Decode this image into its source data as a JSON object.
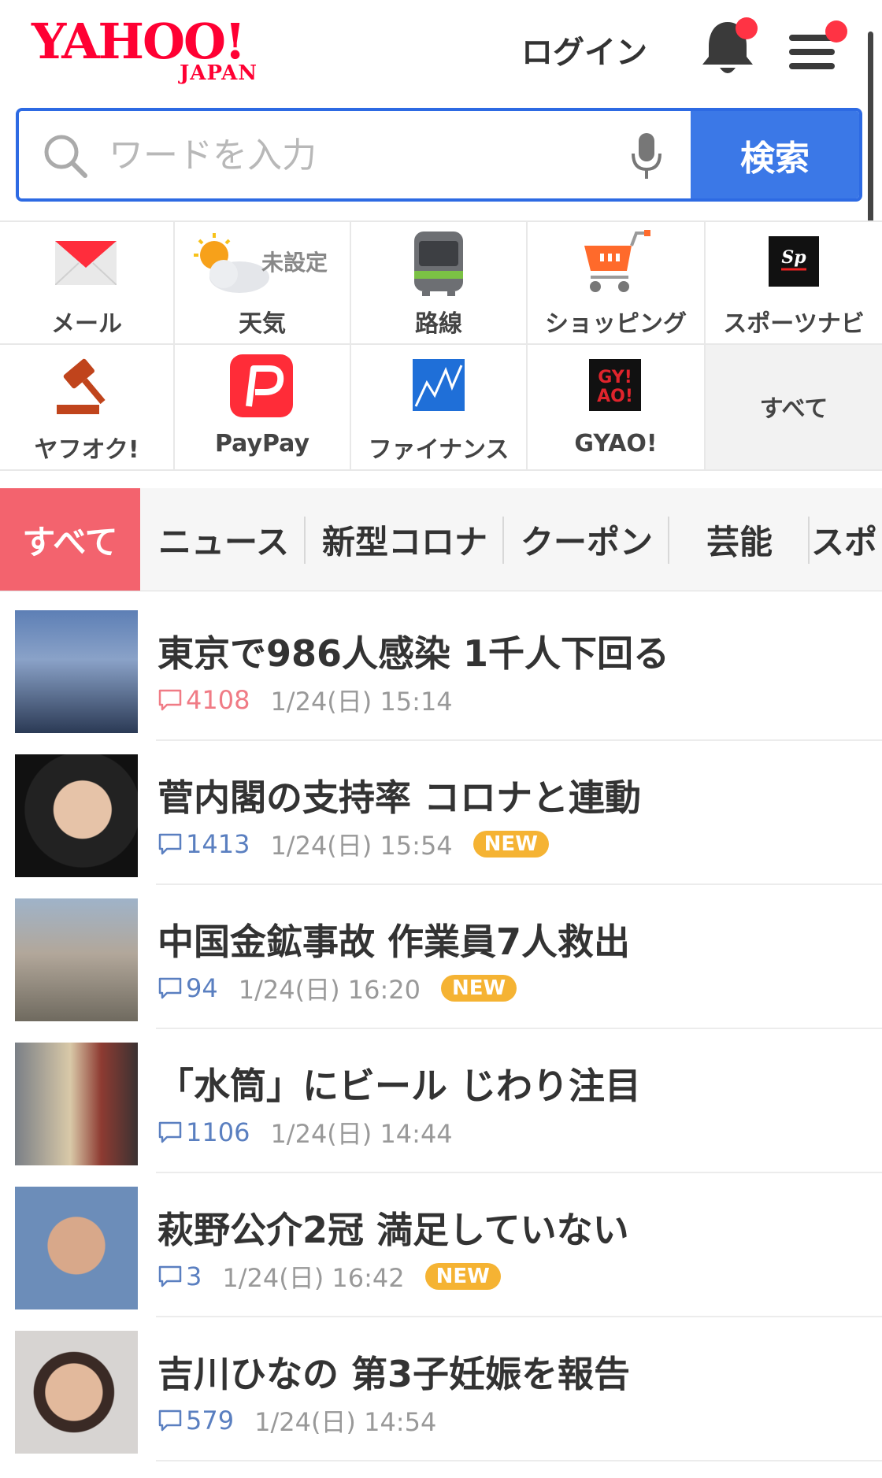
{
  "header": {
    "logo_main": "YAHOO!",
    "logo_sub": "JAPAN",
    "login_label": "ログイン"
  },
  "search": {
    "placeholder": "ワードを入力",
    "button_label": "検索"
  },
  "services": [
    {
      "label": "メール",
      "icon": "mail-icon"
    },
    {
      "label": "天気",
      "icon": "weather-icon",
      "status": "未設定"
    },
    {
      "label": "路線",
      "icon": "train-icon"
    },
    {
      "label": "ショッピング",
      "icon": "cart-icon"
    },
    {
      "label": "スポーツナビ",
      "icon": "sportsnavi-icon"
    },
    {
      "label": "ヤフオク!",
      "icon": "auction-gavel-icon"
    },
    {
      "label": "PayPay",
      "icon": "paypay-icon"
    },
    {
      "label": "ファイナンス",
      "icon": "finance-chart-icon"
    },
    {
      "label": "GYAO!",
      "icon": "gyao-icon"
    },
    {
      "label": "すべて"
    }
  ],
  "tabs": [
    "すべて",
    "ニュース",
    "新型コロナ",
    "クーポン",
    "芸能",
    "スポ"
  ],
  "news": [
    {
      "title": "東京で986人感染 1千人下回る",
      "comments": "4108",
      "time": "1/24(日) 15:14",
      "new": false,
      "hot": true
    },
    {
      "title": "菅内閣の支持率 コロナと連動",
      "comments": "1413",
      "time": "1/24(日) 15:54",
      "new": true,
      "hot": false
    },
    {
      "title": "中国金鉱事故 作業員7人救出",
      "comments": "94",
      "time": "1/24(日) 16:20",
      "new": true,
      "hot": false
    },
    {
      "title": "「水筒」にビール じわり注目",
      "comments": "1106",
      "time": "1/24(日) 14:44",
      "new": false,
      "hot": false
    },
    {
      "title": "萩野公介2冠 満足していない",
      "comments": "3",
      "time": "1/24(日) 16:42",
      "new": true,
      "hot": false
    },
    {
      "title": "吉川ひなの 第3子妊娠を報告",
      "comments": "579",
      "time": "1/24(日) 14:54",
      "new": false,
      "hot": false
    }
  ],
  "new_badge": "NEW",
  "colors": {
    "brand_red": "#ff0033",
    "search_blue": "#3b78e7",
    "active_tab": "#f3636e",
    "badge": "#f5b333"
  }
}
